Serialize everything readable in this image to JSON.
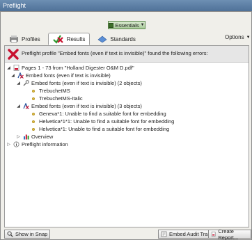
{
  "window": {
    "title": "Preflight"
  },
  "workspace": {
    "label": "Essentials"
  },
  "tabs": [
    {
      "label": "Profiles",
      "icon": "profiles-icon"
    },
    {
      "label": "Results",
      "icon": "results-icon"
    },
    {
      "label": "Standards",
      "icon": "standards-icon"
    }
  ],
  "options": {
    "label": "Options"
  },
  "error_banner": {
    "message": "Preflight profile \"Embed fonts (even if text is invisible)\" found the following errors:"
  },
  "tree": {
    "root": "Pages 1 - 73 from \"Holland Digester O&M D.pdf\"",
    "group": "Embed fonts (even if text is invisible)",
    "info_node": "Embed fonts (even if text is invisible) (2 objects)",
    "info_items": [
      "TrebuchetMS",
      "TrebuchetMS-Italic"
    ],
    "error_node": "Embed fonts (even if text is invisible) (3 objects)",
    "error_items": [
      "Geneva*1: Unable to find a suitable font for embedding",
      "Helvetica*1*1: Unable to find a suitable font for embedding",
      "Helvetica*1: Unable to find a suitable font for embedding"
    ],
    "overview": "Overview",
    "preflight_info": "Preflight information"
  },
  "footer": {
    "show_in_snap": "Show in Snap",
    "embed_audit": "Embed Audit Trail...",
    "create_report": "Create Report..."
  }
}
